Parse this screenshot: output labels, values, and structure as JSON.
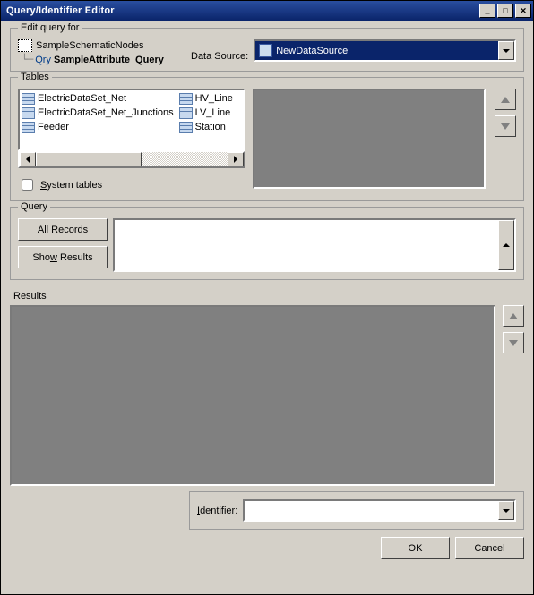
{
  "window": {
    "title": "Query/Identifier Editor"
  },
  "editQuery": {
    "legend": "Edit query for",
    "root": "SampleSchematicNodes",
    "childPrefix": "Qry",
    "child": "SampleAttribute_Query",
    "dataSourceLabel": "Data Source:",
    "dataSource": "NewDataSource"
  },
  "tables": {
    "legend": "Tables",
    "items": [
      "ElectricDataSet_Net",
      "ElectricDataSet_Net_Junctions",
      "Feeder",
      "HV_Line",
      "LV_Line",
      "Station"
    ],
    "systemTables": "System tables"
  },
  "query": {
    "legend": "Query",
    "allRecords": "All Records",
    "showResults": "Show Results",
    "text": ""
  },
  "results": {
    "label": "Results"
  },
  "identifier": {
    "label": "Identifier:",
    "value": ""
  },
  "footer": {
    "ok": "OK",
    "cancel": "Cancel"
  }
}
